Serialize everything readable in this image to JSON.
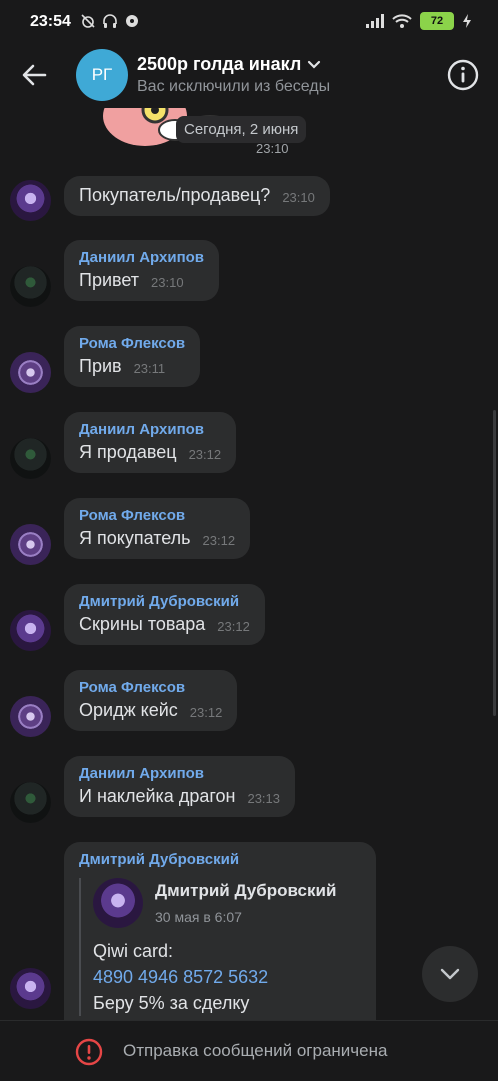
{
  "status_bar": {
    "time": "23:54",
    "battery": "72"
  },
  "header": {
    "avatar_initials": "РГ",
    "title": "2500р голда инакл",
    "subtitle": "Вас исключили из беседы"
  },
  "feed": {
    "date_pill": "Сегодня, 2 июня",
    "sticker_time": "23:10"
  },
  "messages": [
    {
      "author": "",
      "text": "Покупатель/продавец?",
      "time": "23:10"
    },
    {
      "author": "Даниил Архипов",
      "text": "Привет",
      "time": "23:10"
    },
    {
      "author": "Рома Флексов",
      "text": "Прив",
      "time": "23:11"
    },
    {
      "author": "Даниил Архипов",
      "text": "Я продавец",
      "time": "23:12"
    },
    {
      "author": "Рома Флексов",
      "text": "Я покупатель",
      "time": "23:12"
    },
    {
      "author": "Дмитрий Дубровский",
      "text": "Скрины товара",
      "time": "23:12"
    },
    {
      "author": "Рома Флексов",
      "text": "Оридж кейс",
      "time": "23:12"
    },
    {
      "author": "Даниил Архипов",
      "text": "И наклейка драгон",
      "time": "23:13"
    },
    {
      "author": "Дмитрий Дубровский",
      "forward": {
        "name": "Дмитрий Дубровский",
        "date": "30 мая в 6:07",
        "line1": "Qiwi card:",
        "card_number": "4890 4946 8572 5632",
        "line3": "Беру 5% за сделку"
      }
    }
  ],
  "bottom": {
    "notice": "Отправка сообщений ограничена"
  },
  "colors": {
    "background": "#19191a",
    "bubble": "#2c2d2e",
    "author": "#71aaeb",
    "accent_avatar": "#3fa9d6",
    "warning": "#e64646"
  }
}
